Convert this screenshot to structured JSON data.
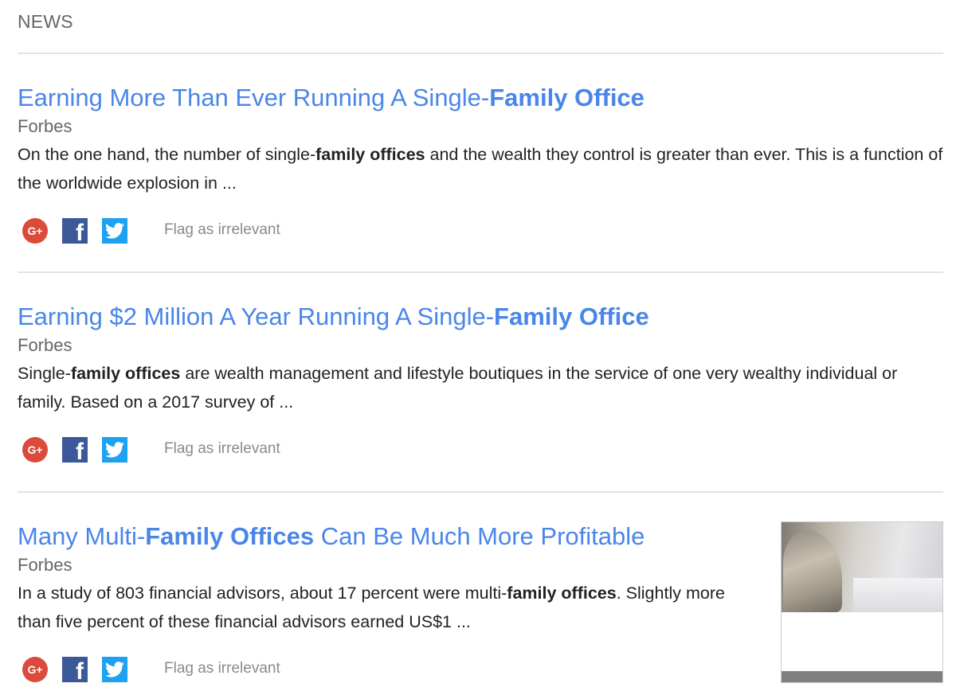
{
  "section_label": "NEWS",
  "items": [
    {
      "headline_pre": "Earning More Than Ever Running A Single-",
      "headline_bold": "Family Office",
      "headline_post": "",
      "source": "Forbes",
      "snippet_pre": "On the one hand, the number of single-",
      "snippet_bold": "family offices",
      "snippet_post": " and the wealth they control is greater than ever. This is a function of the worldwide explosion in ...",
      "flag_label": "Flag as irrelevant"
    },
    {
      "headline_pre": "Earning $2 Million A Year Running A Single-",
      "headline_bold": "Family Office",
      "headline_post": "",
      "source": "Forbes",
      "snippet_pre": "Single-",
      "snippet_bold": "family offices",
      "snippet_post": " are wealth management and lifestyle boutiques in the service of one very wealthy individual or family. Based on a 2017 survey of ...",
      "flag_label": "Flag as irrelevant"
    },
    {
      "headline_pre": "Many Multi-",
      "headline_bold": "Family Offices",
      "headline_post": " Can Be Much More Profitable",
      "source": "Forbes",
      "snippet_pre": "In a study of 803 financial advisors, about 17 percent were multi-",
      "snippet_bold": "family offices",
      "snippet_post": ". Slightly more than five percent of these financial advisors earned US$1 ...",
      "flag_label": "Flag as irrelevant"
    }
  ],
  "share_icons": {
    "gplus_glyph": "G+",
    "facebook_glyph": "f"
  },
  "colors": {
    "link": "#4a86e8",
    "gplus": "#db4a3a",
    "facebook": "#3b5998",
    "twitter": "#1da1f2"
  }
}
